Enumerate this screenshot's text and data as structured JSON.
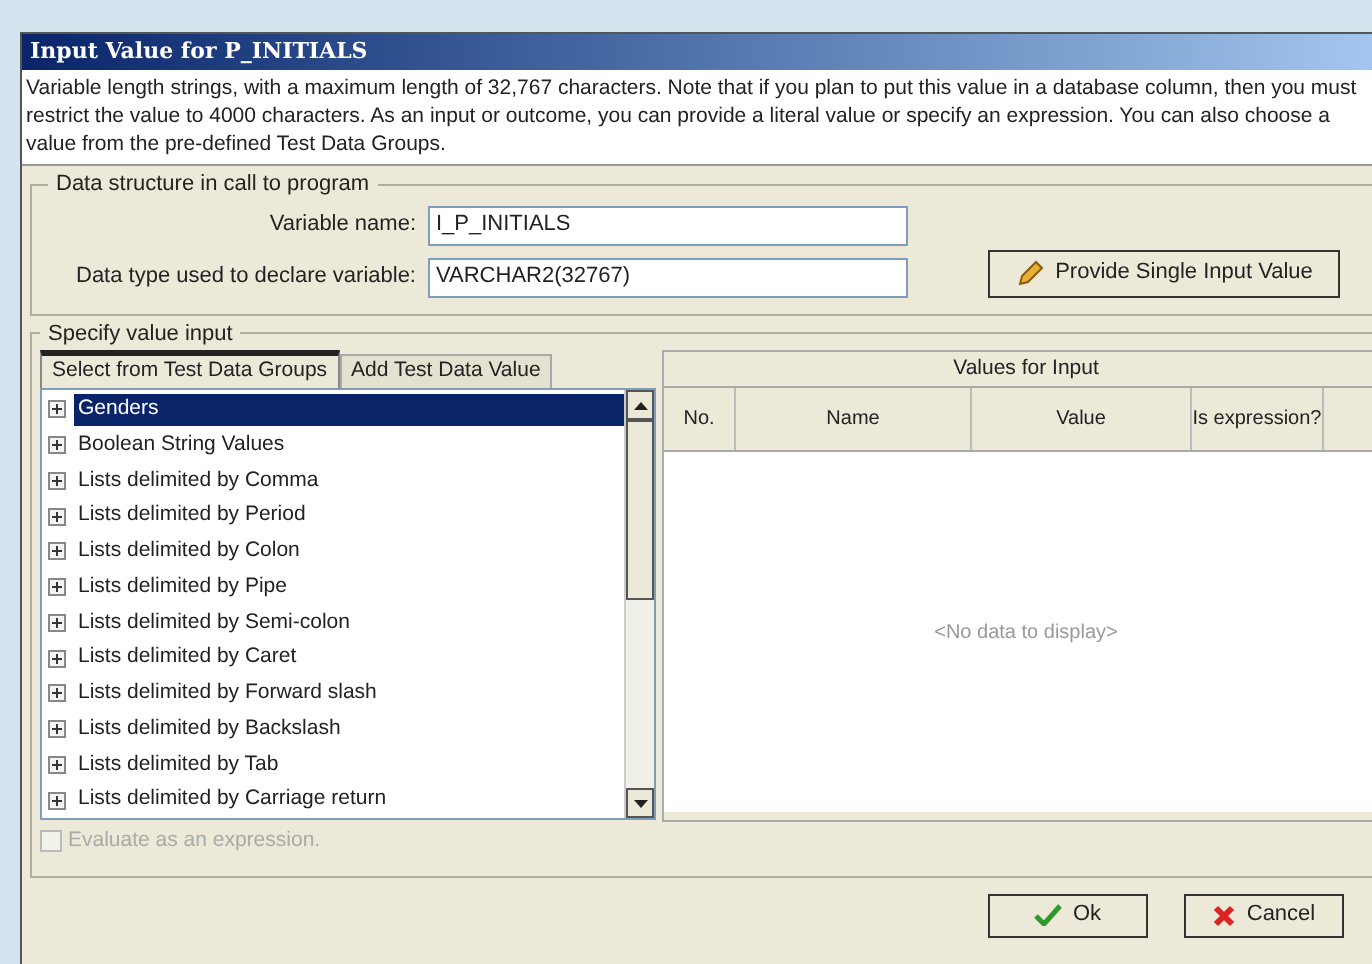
{
  "window": {
    "title": "Input Value for P_INITIALS"
  },
  "description": "Variable length strings, with a maximum length of 32,767 characters. Note that if you plan to put this value in a database column, then you must restrict the value to 4000 characters. As an input or outcome, you can provide a literal value or specify an expression. You can also choose a value from the pre-defined Test Data Groups.",
  "data_structure": {
    "legend": "Data structure in call to program",
    "fields": [
      {
        "label": "Variable name:",
        "value": "I_P_INITIALS"
      },
      {
        "label": "Data type used to declare variable:",
        "value": "VARCHAR2(32767)"
      }
    ],
    "button": "Provide Single Input Value"
  },
  "value_input": {
    "legend": "Specify value input",
    "tabs": [
      {
        "label": "Select from Test Data Groups",
        "selected": true
      },
      {
        "label": "Add Test Data Value",
        "selected": false
      }
    ],
    "groups": [
      {
        "label": "Genders",
        "selected": true
      },
      {
        "label": "Boolean String Values",
        "selected": false
      },
      {
        "label": "Lists delimited by Comma",
        "selected": false
      },
      {
        "label": "Lists delimited by Period",
        "selected": false
      },
      {
        "label": "Lists delimited by Colon",
        "selected": false
      },
      {
        "label": "Lists delimited by Pipe",
        "selected": false
      },
      {
        "label": "Lists delimited by Semi-colon",
        "selected": false
      },
      {
        "label": "Lists delimited by Caret",
        "selected": false
      },
      {
        "label": "Lists delimited by Forward slash",
        "selected": false
      },
      {
        "label": "Lists delimited by Backslash",
        "selected": false
      },
      {
        "label": "Lists delimited by Tab",
        "selected": false
      },
      {
        "label": "Lists delimited by Carriage return",
        "selected": false
      }
    ],
    "expression_checkbox": {
      "label": "Evaluate as an expression.",
      "checked": false,
      "disabled": true
    },
    "table": {
      "title": "Values for Input",
      "columns": [
        "No.",
        "Name",
        "Value",
        "Is expression?"
      ],
      "empty_text": "<No data to display>"
    }
  },
  "buttons": [
    {
      "kind": "ok",
      "label": "Ok"
    },
    {
      "kind": "cancel",
      "label": "Cancel"
    }
  ]
}
